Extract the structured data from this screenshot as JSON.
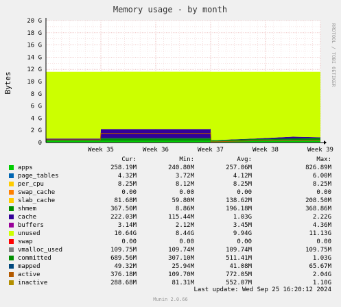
{
  "title": "Memory usage - by month",
  "side_label": "RRDTOOL / TOBI OETIKER",
  "y_axis_label": "Bytes",
  "x_ticks": [
    "Week 35",
    "Week 36",
    "Week 37",
    "Week 38",
    "Week 39"
  ],
  "y_ticks": [
    "0",
    "2 G",
    "4 G",
    "6 G",
    "8 G",
    "10 G",
    "12 G",
    "14 G",
    "16 G",
    "18 G",
    "20 G"
  ],
  "legend_header": {
    "cur": "Cur:",
    "min": "Min:",
    "avg": "Avg:",
    "max": "Max:"
  },
  "legend": [
    {
      "name": "apps",
      "color": "#00cc00",
      "cur": "258.19M",
      "min": "240.80M",
      "avg": "257.06M",
      "max": "826.89M"
    },
    {
      "name": "page_tables",
      "color": "#0066b3",
      "cur": "4.32M",
      "min": "3.72M",
      "avg": "4.12M",
      "max": "6.00M"
    },
    {
      "name": "per_cpu",
      "color": "#ffcc00",
      "cur": "8.25M",
      "min": "8.12M",
      "avg": "8.25M",
      "max": "8.25M"
    },
    {
      "name": "swap_cache",
      "color": "#ff8000",
      "cur": "0.00",
      "min": "0.00",
      "avg": "0.00",
      "max": "0.00"
    },
    {
      "name": "slab_cache",
      "color": "#ffcc00",
      "cur": "81.68M",
      "min": "59.80M",
      "avg": "138.62M",
      "max": "208.50M"
    },
    {
      "name": "shmem",
      "color": "#008f00",
      "cur": "367.50M",
      "min": "8.86M",
      "avg": "196.18M",
      "max": "368.86M"
    },
    {
      "name": "cache",
      "color": "#330099",
      "cur": "222.03M",
      "min": "115.44M",
      "avg": "1.03G",
      "max": "2.22G"
    },
    {
      "name": "buffers",
      "color": "#990099",
      "cur": "3.14M",
      "min": "2.12M",
      "avg": "3.45M",
      "max": "4.36M"
    },
    {
      "name": "unused",
      "color": "#ccff00",
      "cur": "10.64G",
      "min": "8.44G",
      "avg": "9.94G",
      "max": "11.13G"
    },
    {
      "name": "swap",
      "color": "#ff0000",
      "cur": "0.00",
      "min": "0.00",
      "avg": "0.00",
      "max": "0.00"
    },
    {
      "name": "vmalloc_used",
      "color": "#808080",
      "cur": "109.75M",
      "min": "109.74M",
      "avg": "109.74M",
      "max": "109.75M"
    },
    {
      "name": "committed",
      "color": "#008f00",
      "cur": "689.56M",
      "min": "307.10M",
      "avg": "511.41M",
      "max": "1.03G"
    },
    {
      "name": "mapped",
      "color": "#00487d",
      "cur": "49.32M",
      "min": "25.94M",
      "avg": "41.08M",
      "max": "65.67M"
    },
    {
      "name": "active",
      "color": "#b35a00",
      "cur": "376.18M",
      "min": "109.70M",
      "avg": "772.05M",
      "max": "2.04G"
    },
    {
      "name": "inactive",
      "color": "#b38f00",
      "cur": "288.68M",
      "min": "81.31M",
      "avg": "552.07M",
      "max": "1.10G"
    }
  ],
  "last_update": "Last update: Wed Sep 25 16:20:12 2024",
  "version": "Munin 2.0.66",
  "chart_data": {
    "type": "area",
    "title": "Memory usage - by month",
    "ylabel": "Bytes",
    "ylim": [
      0,
      20
    ],
    "y_unit": "G",
    "grid": true,
    "x_ticks": [
      "Week 35",
      "Week 36",
      "Week 37",
      "Week 38",
      "Week 39"
    ],
    "x": [
      34.0,
      34.99,
      35.0,
      36.99,
      37.0,
      37.01,
      37.8,
      38.5,
      39.0
    ],
    "stacked_series": [
      {
        "name": "apps",
        "color": "#00cc00",
        "values": [
          0.25,
          0.25,
          0.26,
          0.26,
          0.26,
          0.25,
          0.25,
          0.26,
          0.26
        ]
      },
      {
        "name": "shmem",
        "color": "#008f00",
        "values": [
          0.1,
          0.1,
          0.35,
          0.35,
          0.35,
          0.01,
          0.2,
          0.3,
          0.37
        ]
      },
      {
        "name": "cache",
        "color": "#330099",
        "values": [
          0.3,
          0.3,
          1.6,
          1.6,
          1.7,
          0.12,
          0.2,
          0.4,
          0.22
        ]
      },
      {
        "name": "unused",
        "color": "#ccff00",
        "values": [
          10.95,
          10.95,
          9.4,
          9.4,
          9.3,
          11.22,
          10.95,
          10.64,
          10.75
        ]
      }
    ],
    "line_series": [
      {
        "name": "committed",
        "color": "#008f00",
        "values": [
          0.4,
          0.4,
          0.7,
          0.7,
          0.75,
          0.31,
          0.5,
          0.6,
          0.69
        ]
      },
      {
        "name": "active",
        "color": "#b35a00",
        "values": [
          0.45,
          0.45,
          1.5,
          1.5,
          1.6,
          0.11,
          0.3,
          0.35,
          0.38
        ]
      },
      {
        "name": "swap",
        "color": "#ff0000",
        "values": [
          0.0,
          0.0,
          0.0,
          0.0,
          0.0,
          0.0,
          0.0,
          0.0,
          0.0
        ]
      }
    ]
  }
}
